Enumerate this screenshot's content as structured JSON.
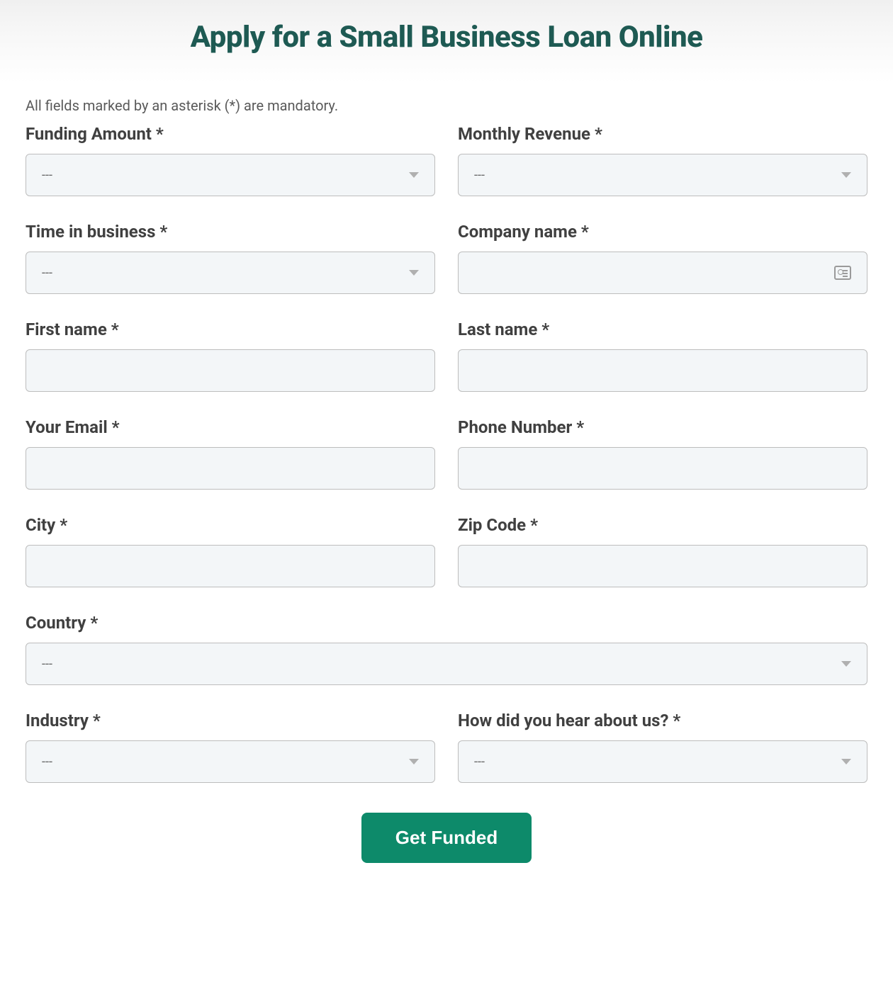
{
  "header": {
    "title": "Apply for a Small Business Loan Online"
  },
  "form": {
    "mandatory_note": "All fields marked by an asterisk (*) are mandatory.",
    "fields": {
      "funding_amount": {
        "label": "Funding Amount *",
        "value": "---"
      },
      "monthly_revenue": {
        "label": "Monthly Revenue *",
        "value": "---"
      },
      "time_in_business": {
        "label": "Time in business *",
        "value": "---"
      },
      "company_name": {
        "label": "Company name *",
        "value": ""
      },
      "first_name": {
        "label": "First name *",
        "value": ""
      },
      "last_name": {
        "label": "Last name *",
        "value": ""
      },
      "email": {
        "label": "Your Email *",
        "value": ""
      },
      "phone": {
        "label": "Phone Number *",
        "value": ""
      },
      "city": {
        "label": "City *",
        "value": ""
      },
      "zip": {
        "label": "Zip Code *",
        "value": ""
      },
      "country": {
        "label": "Country *",
        "value": "---"
      },
      "industry": {
        "label": "Industry *",
        "value": "---"
      },
      "hear_about": {
        "label": "How did you hear about us? *",
        "value": "---"
      }
    },
    "submit_label": "Get Funded"
  }
}
